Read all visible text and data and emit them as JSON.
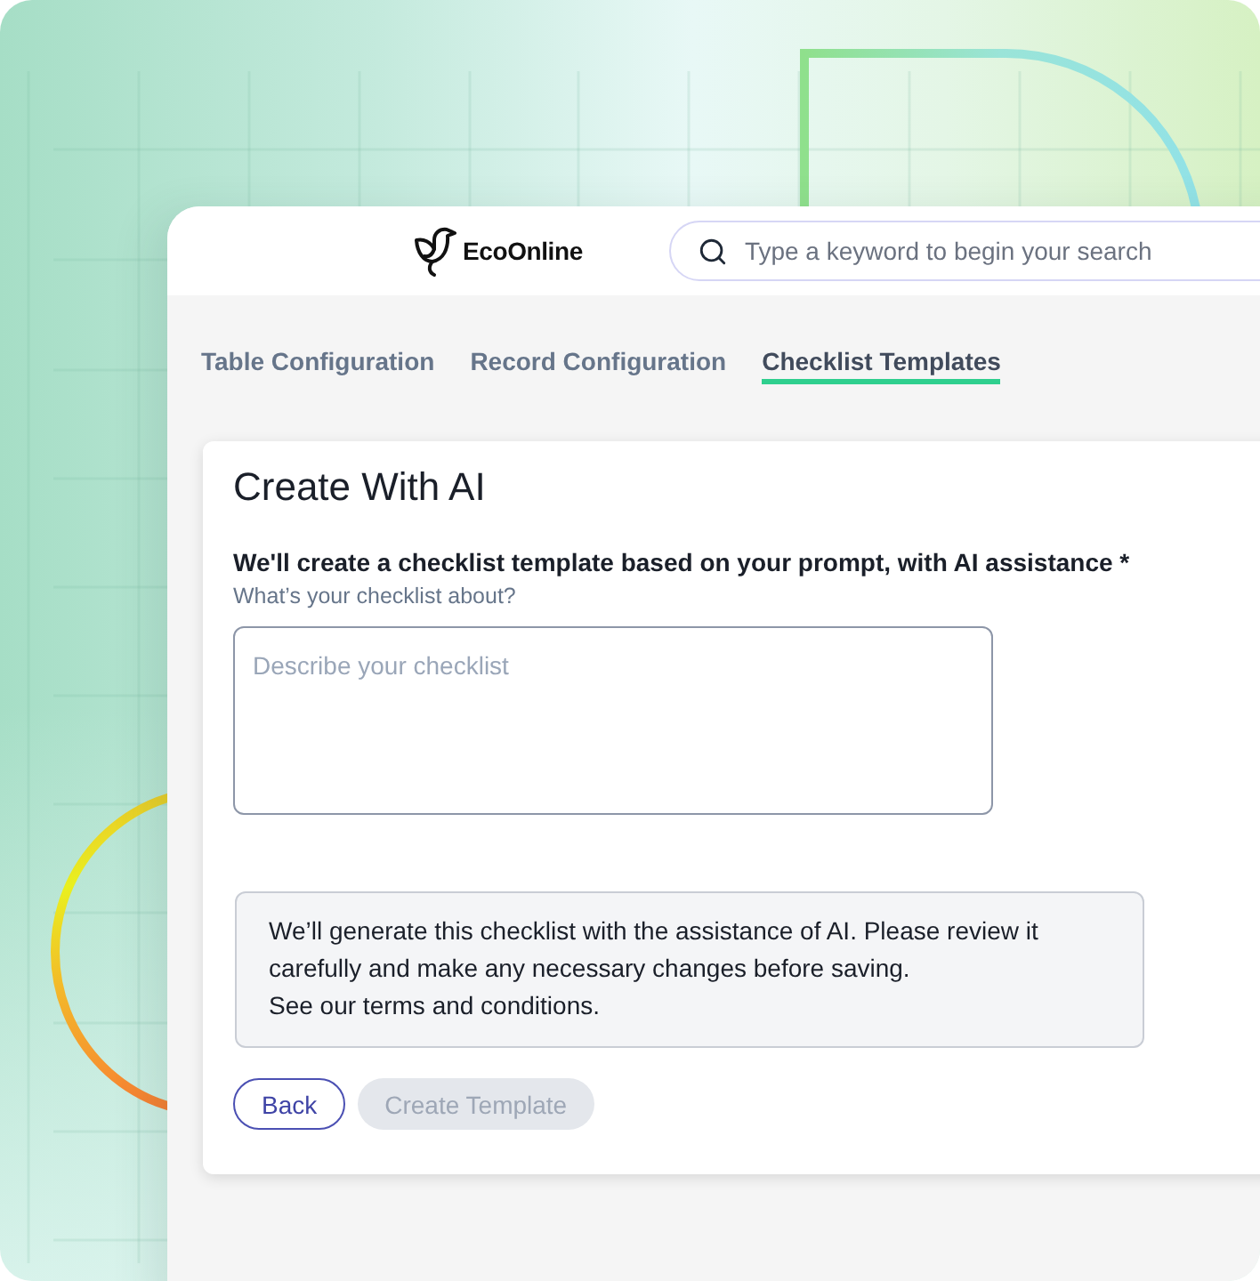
{
  "header": {
    "logo": {
      "text": "EcoOnline"
    },
    "search": {
      "placeholder": "Type a keyword to begin your search"
    }
  },
  "tabs": [
    {
      "label": "Table Configuration",
      "selected": false
    },
    {
      "label": "Record Configuration",
      "selected": false
    },
    {
      "label": "Checklist Templates",
      "selected": true
    }
  ],
  "card": {
    "title": "Create With AI",
    "prompt_label": "We'll create a checklist template based on your prompt, with AI assistance *",
    "hint": "What’s your checklist about?",
    "textarea": {
      "placeholder": "Describe your checklist"
    },
    "notice": {
      "lines": [
        "We’ll generate this checklist with the assistance of AI. Please review it carefully and make any necessary changes before saving.",
        "See our terms and conditions."
      ]
    },
    "buttons": [
      {
        "label": "Back",
        "kind": "outline",
        "disabled": false
      },
      {
        "label": "Create Template",
        "kind": "filled",
        "disabled": true
      }
    ]
  }
}
